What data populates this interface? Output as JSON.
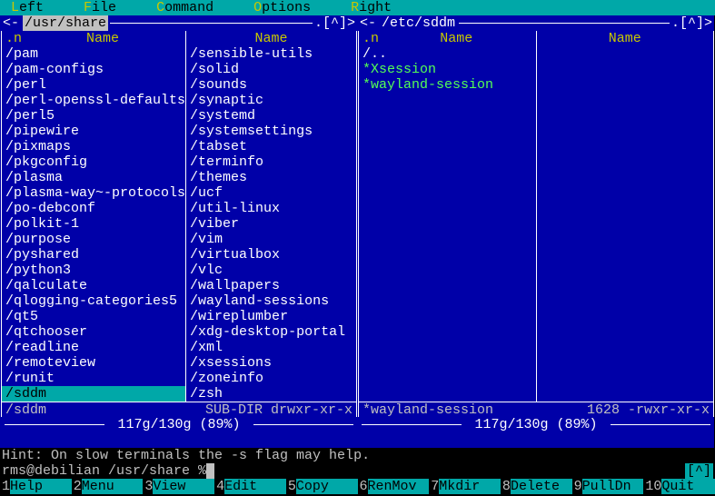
{
  "menubar": [
    {
      "hotkey": "L",
      "rest": "eft"
    },
    {
      "hotkey": "F",
      "rest": "ile"
    },
    {
      "hotkey": "C",
      "rest": "ommand"
    },
    {
      "hotkey": "O",
      "rest": "ptions"
    },
    {
      "hotkey": "R",
      "rest": "ight"
    }
  ],
  "left_panel": {
    "arrow": "<-",
    "path": "/usr/share",
    "corner": ".[^]>",
    "col1_header_n": ".n",
    "col1_header_name": "Name",
    "col2_header_name": "Name",
    "col1": [
      "/pam",
      "/pam-configs",
      "/perl",
      "/perl-openssl-defaults",
      "/perl5",
      "/pipewire",
      "/pixmaps",
      "/pkgconfig",
      "/plasma",
      "/plasma-way~-protocols",
      "/po-debconf",
      "/polkit-1",
      "/purpose",
      "/pyshared",
      "/python3",
      "/qalculate",
      "/qlogging-categories5",
      "/qt5",
      "/qtchooser",
      "/readline",
      "/remoteview",
      "/runit",
      "/sddm"
    ],
    "col1_selected": 22,
    "col2": [
      "/sensible-utils",
      "/solid",
      "/sounds",
      "/synaptic",
      "/systemd",
      "/systemsettings",
      "/tabset",
      "/terminfo",
      "/themes",
      "/ucf",
      "/util-linux",
      "/viber",
      "/vim",
      "/virtualbox",
      "/vlc",
      "/wallpapers",
      "/wayland-sessions",
      "/wireplumber",
      "/xdg-desktop-portal",
      "/xml",
      "/xsessions",
      "/zoneinfo",
      "/zsh"
    ],
    "status_name": "/sddm",
    "status_info": "SUB-DIR drwxr-xr-x",
    "disk": "117g/130g (89%)"
  },
  "right_panel": {
    "arrow": "<-",
    "path": "/etc/sddm",
    "corner": ".[^]>",
    "col1_header_n": ".n",
    "col1_header_name": "Name",
    "col2_header_name": "Name",
    "col1": [
      {
        "text": "/..",
        "special": false
      },
      {
        "text": "*Xsession",
        "special": true
      },
      {
        "text": "*wayland-session",
        "special": true
      }
    ],
    "status_name": "*wayland-session",
    "status_info": "1628 -rwxr-xr-x",
    "disk": "117g/130g (89%)"
  },
  "hint": "Hint: On slow terminals the -s flag may help.",
  "prompt": "rms@debilian /usr/share % ",
  "prompt_corner": "[^]",
  "fkeys": [
    {
      "num": "1",
      "label": "Help"
    },
    {
      "num": "2",
      "label": "Menu"
    },
    {
      "num": "3",
      "label": "View"
    },
    {
      "num": "4",
      "label": "Edit"
    },
    {
      "num": "5",
      "label": "Copy"
    },
    {
      "num": "6",
      "label": "RenMov"
    },
    {
      "num": "7",
      "label": "Mkdir"
    },
    {
      "num": "8",
      "label": "Delete"
    },
    {
      "num": "9",
      "label": "PullDn"
    },
    {
      "num": "10",
      "label": "Quit"
    }
  ]
}
